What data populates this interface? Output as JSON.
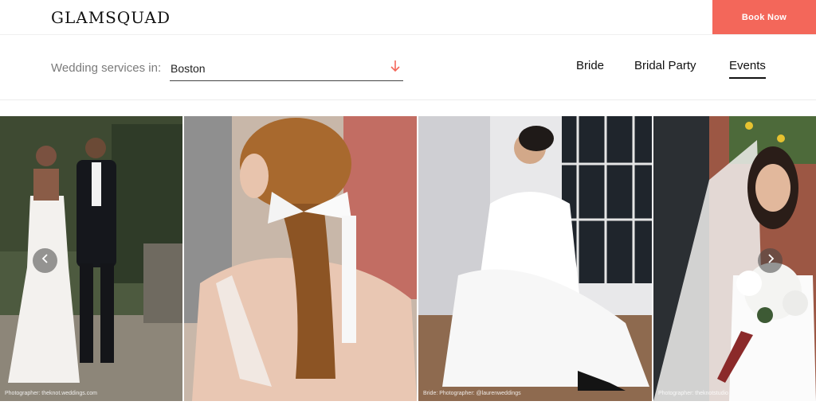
{
  "header": {
    "logo": "GLAMSQUAD",
    "book_now": "Book Now"
  },
  "filter": {
    "label": "Wedding services in:",
    "city": "Boston",
    "arrow_icon": "arrow-down-icon"
  },
  "tabs": [
    {
      "label": "Bride"
    },
    {
      "label": "Bridal Party"
    },
    {
      "label": "Events",
      "active": true
    }
  ],
  "gallery": {
    "photos": [
      {
        "subject": "bride-and-groom-photo",
        "credit": "Photographer: theknot.weddings.com"
      },
      {
        "subject": "bride-ribbon-hairstyle-photo",
        "credit": ""
      },
      {
        "subject": "bride-seated-photo",
        "credit": "Bride: Photographer: @laurenweddings"
      },
      {
        "subject": "bride-with-bouquet-photo",
        "credit": "Photographer: theknotstudio"
      }
    ],
    "prev_icon": "chevron-left-icon",
    "next_icon": "chevron-right-icon"
  },
  "colors": {
    "accent": "#f3675a",
    "text": "#111111",
    "muted": "#7b7b7b"
  }
}
